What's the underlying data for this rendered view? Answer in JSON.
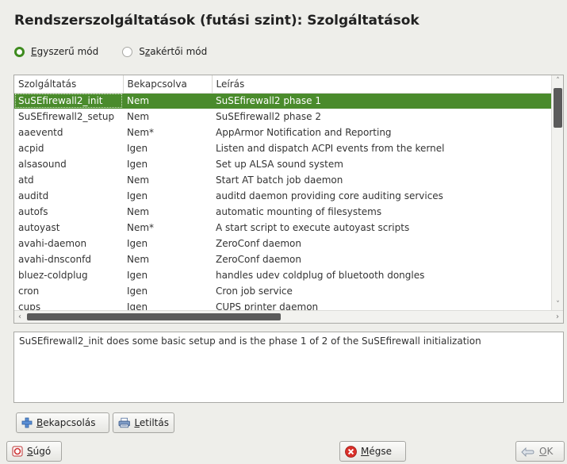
{
  "title": "Rendszerszolgáltatások (futási szint): Szolgáltatások",
  "modes": {
    "simple_accel": "E",
    "simple_rest": "gyszerű mód",
    "expert_pre": "S",
    "expert_accel": "z",
    "expert_rest": "akértői mód",
    "selected": "simple"
  },
  "table": {
    "columns": [
      "Szolgáltatás",
      "Bekapcsolva",
      "Leírás"
    ],
    "rows": [
      [
        "SuSEfirewall2_init",
        "Nem",
        "SuSEfirewall2 phase 1"
      ],
      [
        "SuSEfirewall2_setup",
        "Nem",
        "SuSEfirewall2 phase 2"
      ],
      [
        "aaeventd",
        "Nem*",
        "AppArmor Notification and Reporting"
      ],
      [
        "acpid",
        "Igen",
        "Listen and dispatch ACPI events from the kernel"
      ],
      [
        "alsasound",
        "Igen",
        "Set up ALSA sound system"
      ],
      [
        "atd",
        "Nem",
        "Start AT batch job daemon"
      ],
      [
        "auditd",
        "Igen",
        "auditd daemon providing core auditing services"
      ],
      [
        "autofs",
        "Nem",
        "automatic mounting of filesystems"
      ],
      [
        "autoyast",
        "Nem*",
        "A start script to execute autoyast scripts"
      ],
      [
        "avahi-daemon",
        "Igen",
        "ZeroConf daemon"
      ],
      [
        "avahi-dnsconfd",
        "Nem",
        "ZeroConf daemon"
      ],
      [
        "bluez-coldplug",
        "Igen",
        "handles udev coldplug of bluetooth dongles"
      ],
      [
        "cron",
        "Igen",
        "Cron job service"
      ],
      [
        "cups",
        "Igen",
        "CUPS printer daemon"
      ]
    ],
    "selected_index": 0
  },
  "description": "SuSEfirewall2_init does some basic setup and is the phase 1 of 2 of the SuSEfirewall initialization",
  "buttons": {
    "enable_accel": "B",
    "enable_rest": "ekapcsolás",
    "disable_accel": "L",
    "disable_rest": "etiltás",
    "help_accel": "S",
    "help_rest": "úgó",
    "cancel_accel": "M",
    "cancel_rest": "égse",
    "ok_accel": "O",
    "ok_rest": "K"
  },
  "colors": {
    "selection": "#4a8b2c",
    "radio_checked": "#3e8b1f"
  },
  "icons": {
    "enable": "plus-icon",
    "disable": "printer-icon",
    "help": "help-icon",
    "cancel": "cancel-icon",
    "ok": "ok-hand-icon"
  }
}
